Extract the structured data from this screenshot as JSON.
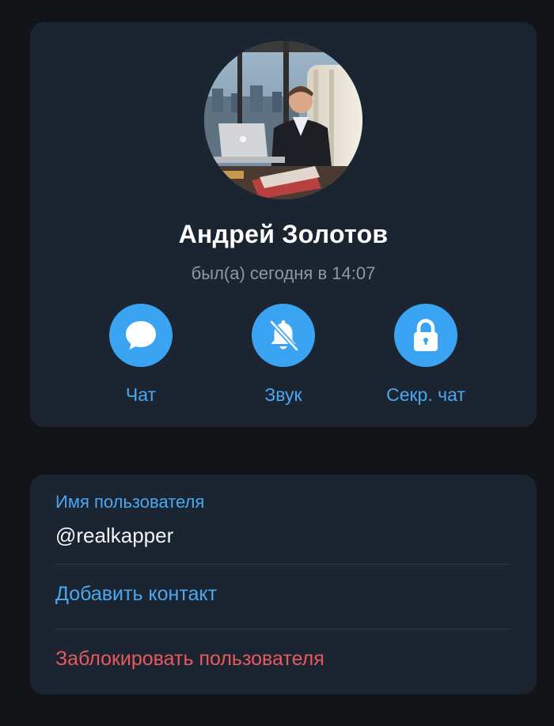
{
  "profile": {
    "name": "Андрей Золотов",
    "status": "был(а) сегодня в 14:07"
  },
  "actions": [
    {
      "label": "Чат",
      "icon": "chat-bubble-icon"
    },
    {
      "label": "Звук",
      "icon": "bell-muted-icon"
    },
    {
      "label": "Секр. чат",
      "icon": "lock-icon"
    }
  ],
  "info": {
    "username_label": "Имя пользователя",
    "username_value": "@realkapper",
    "add_contact": "Добавить контакт",
    "block_user": "Заблокировать пользователя"
  },
  "colors": {
    "background": "#131417",
    "card": "#1b2431",
    "accent": "#3aa4f2",
    "link": "#4aa8f0",
    "danger": "#e8595f",
    "muted_text": "#8e98a5"
  }
}
